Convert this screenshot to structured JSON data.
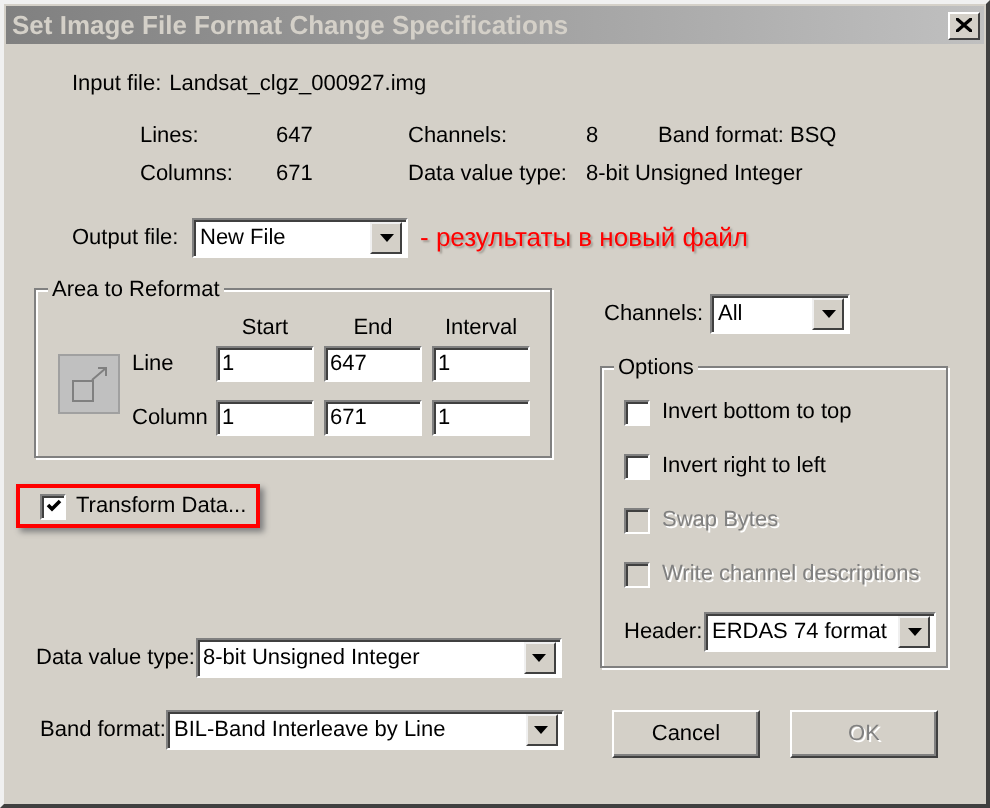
{
  "window": {
    "title": "Set Image File Format Change Specifications"
  },
  "input_file": {
    "label": "Input file:",
    "value": "Landsat_clgz_000927.img"
  },
  "info": [
    [
      {
        "label": "Lines:",
        "value": "647"
      },
      {
        "label": "Channels:",
        "value": "8"
      },
      {
        "label": "Band format:",
        "value": "BSQ"
      }
    ],
    [
      {
        "label": "Columns:",
        "value": "671"
      },
      {
        "label": "Data value type:",
        "value": "8-bit Unsigned Integer"
      }
    ]
  ],
  "output_file": {
    "label": "Output file:",
    "value": "New File",
    "annotation": "- результаты в новый файл"
  },
  "area": {
    "title": "Area to Reformat",
    "columns": [
      "Start",
      "End",
      "Interval"
    ],
    "rows": [
      {
        "label": "Line",
        "values": [
          "1",
          "647",
          "1"
        ]
      },
      {
        "label": "Column",
        "values": [
          "1",
          "671",
          "1"
        ]
      }
    ]
  },
  "transform_data": {
    "label": "Transform Data...",
    "checked": true,
    "highlighted": true
  },
  "channels": {
    "label": "Channels:",
    "value": "All"
  },
  "options": {
    "title": "Options",
    "items": [
      {
        "label": "Invert bottom to top",
        "checked": false,
        "disabled": false
      },
      {
        "label": "Invert right to left",
        "checked": false,
        "disabled": false
      },
      {
        "label": "Swap Bytes",
        "checked": false,
        "disabled": true
      },
      {
        "label": "Write channel descriptions",
        "checked": false,
        "disabled": true
      }
    ],
    "header": {
      "label": "Header:",
      "value": "ERDAS 74 format"
    }
  },
  "data_value_type": {
    "label": "Data value type:",
    "value": "8-bit Unsigned Integer"
  },
  "band_format": {
    "label": "Band format:",
    "value": "BIL-Band Interleave by Line"
  },
  "buttons": [
    {
      "label": "Cancel",
      "disabled": false
    },
    {
      "label": "OK",
      "disabled": true
    }
  ]
}
